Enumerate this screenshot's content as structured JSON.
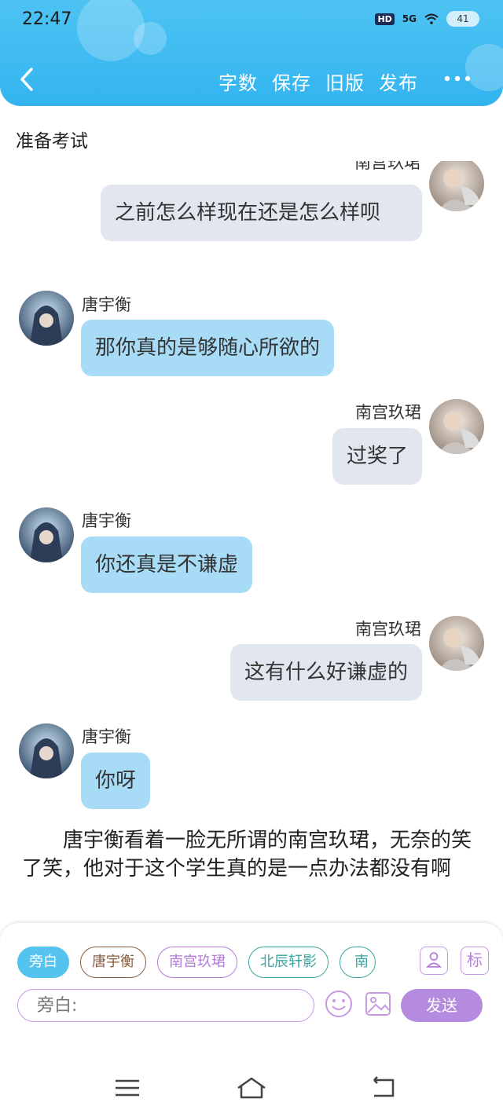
{
  "status_bar": {
    "time": "22:47",
    "hd": "HD",
    "signal": "5G",
    "battery": "41"
  },
  "toolbar": {
    "word_count": "字数",
    "save": "保存",
    "old_version": "旧版",
    "publish": "发布"
  },
  "document": {
    "title": "准备考试"
  },
  "messages": [
    {
      "speaker": "南宫玖珺",
      "text": "之前怎么样现在还是怎么样呗",
      "side": "right",
      "partial_name": true
    },
    {
      "speaker": "唐宇衡",
      "text": "那你真的是够随心所欲的",
      "side": "left"
    },
    {
      "speaker": "南宫玖珺",
      "text": "过奖了",
      "side": "right"
    },
    {
      "speaker": "唐宇衡",
      "text": "你还真是不谦虚",
      "side": "left"
    },
    {
      "speaker": "南宫玖珺",
      "text": "这有什么好谦虚的",
      "side": "right"
    },
    {
      "speaker": "唐宇衡",
      "text": "你呀",
      "side": "left"
    }
  ],
  "narration": "唐宇衡看着一脸无所谓的南宫玖珺，无奈的笑了笑，他对于这个学生真的是一点办法都没有啊",
  "roles": [
    "旁白",
    "唐宇衡",
    "南宫玖珺",
    "北辰轩影",
    "南"
  ],
  "panel": {
    "role_icon_label": "标",
    "input_placeholder": "旁白:",
    "send": "发送"
  },
  "colors": {
    "header": "#33b4ef",
    "blue_bubble": "#a8dcf6",
    "gray_bubble": "#e2e6ee",
    "send": "#b58be0"
  }
}
